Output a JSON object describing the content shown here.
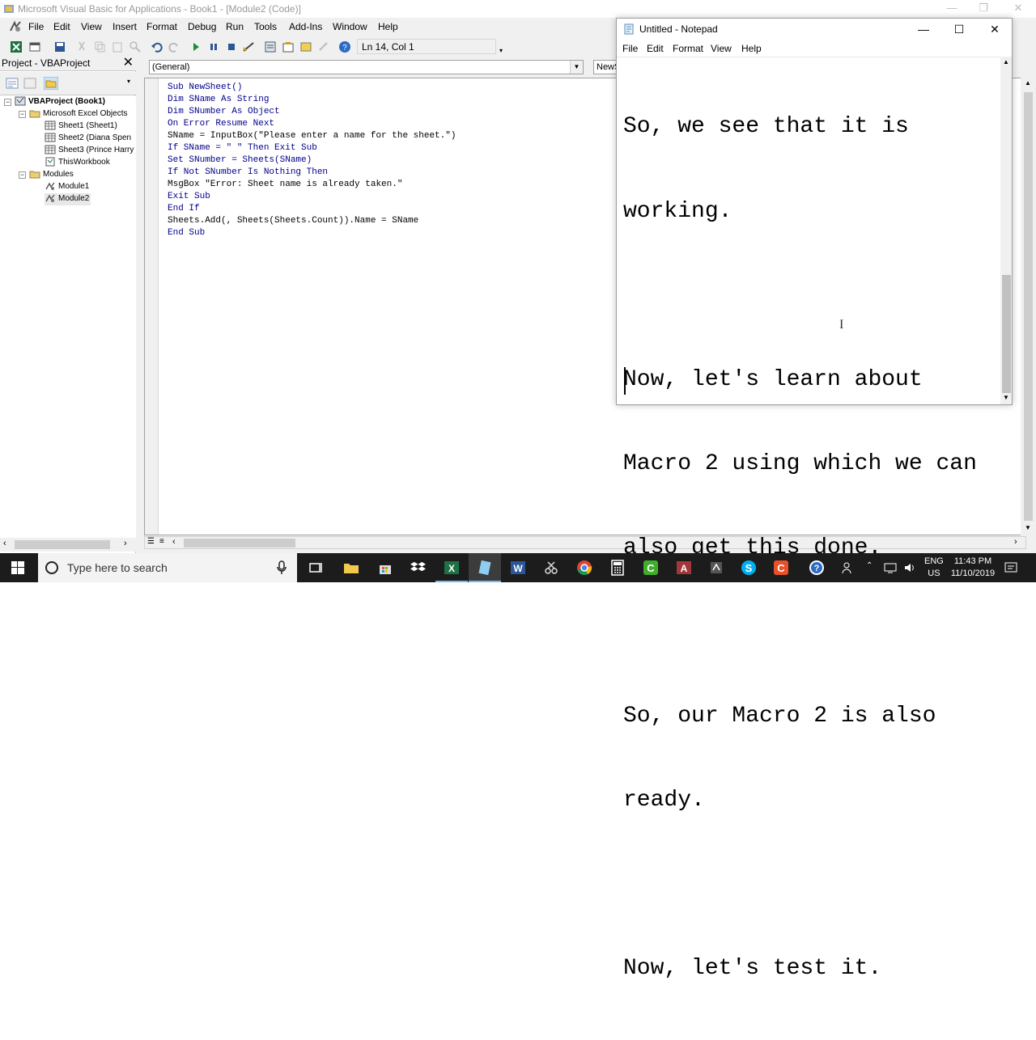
{
  "vbe": {
    "title": "Microsoft Visual Basic for Applications - Book1 - [Module2 (Code)]",
    "menu": [
      "File",
      "Edit",
      "View",
      "Insert",
      "Format",
      "Debug",
      "Run",
      "Tools",
      "Add-Ins",
      "Window",
      "Help"
    ],
    "status": "Ln 14, Col 1",
    "project_pane": {
      "title": "Project - VBAProject",
      "tree": {
        "root": "VBAProject (Book1)",
        "excel_objects_folder": "Microsoft Excel Objects",
        "sheets": [
          "Sheet1 (Sheet1)",
          "Sheet2 (Diana Spen",
          "Sheet3 (Prince Harry",
          "ThisWorkbook"
        ],
        "modules_folder": "Modules",
        "modules": [
          "Module1",
          "Module2"
        ]
      }
    },
    "code": {
      "object_combo": "(General)",
      "procedure_combo": "NewS",
      "lines": [
        "Sub NewSheet()",
        "Dim SName As String",
        "Dim SNumber As Object",
        "On Error Resume Next",
        "SName = InputBox(\"Please enter a name for the sheet.\")",
        "If SName = \" \" Then Exit Sub",
        "Set SNumber = Sheets(SName)",
        "If Not SNumber Is Nothing Then",
        "MsgBox \"Error: Sheet name is already taken.\"",
        "Exit Sub",
        "End If",
        "Sheets.Add(, Sheets(Sheets.Count)).Name = SName",
        "End Sub"
      ]
    }
  },
  "notepad": {
    "title": "Untitled - Notepad",
    "menu": [
      "File",
      "Edit",
      "Format",
      "View",
      "Help"
    ],
    "text_lines": [
      "So, we see that it is",
      "working.",
      "",
      "Now, let's learn about",
      "Macro 2 using which we can",
      "also get this done.",
      "",
      "So, our Macro 2 is also",
      "ready.",
      "",
      "Now, let's test it."
    ]
  },
  "taskbar": {
    "search_placeholder": "Type here to search",
    "language_line1": "ENG",
    "language_line2": "US",
    "time": "11:43 PM",
    "date": "11/10/2019"
  },
  "colors": {
    "taskbar": "#1c1c1c",
    "keyword": "#00008b",
    "active_indicator": "#76b9ed"
  }
}
